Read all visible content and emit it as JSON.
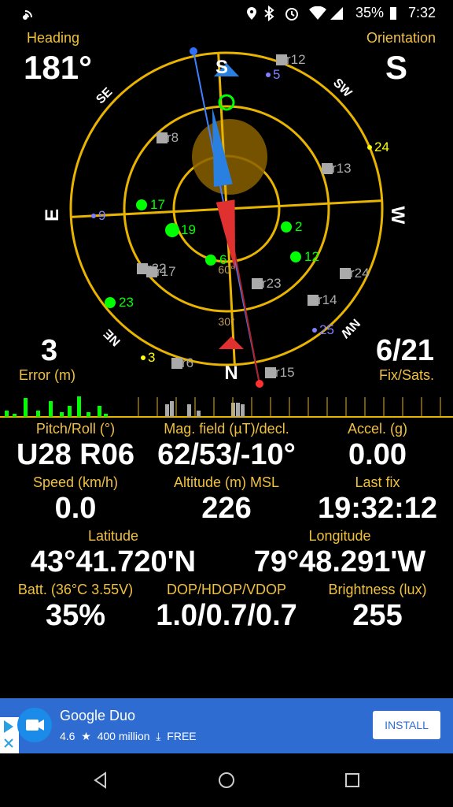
{
  "status": {
    "time": "7:32",
    "battery": "35%"
  },
  "compass": {
    "heading_label": "Heading",
    "heading_value": "181°",
    "orientation_label": "Orientation",
    "orientation_value": "S",
    "error_value": "3",
    "error_label": "Error (m)",
    "fix_value": "6/21",
    "fix_label": "Fix/Sats.",
    "dirs": {
      "top": "S",
      "bottom": "N",
      "left": "E",
      "right": "W",
      "se": "SE",
      "sw": "SW",
      "ne": "NE",
      "nw": "NW"
    },
    "ring_labels": [
      "60°",
      "30°"
    ],
    "satellites": [
      {
        "id": "5",
        "color": "#8080ff"
      },
      {
        "id": "r12",
        "color": "#aaaaaa"
      },
      {
        "id": "r8",
        "color": "#aaaaaa"
      },
      {
        "id": "24",
        "color": "#ffff00"
      },
      {
        "id": "r13",
        "color": "#aaaaaa"
      },
      {
        "id": "9",
        "color": "#8080ff"
      },
      {
        "id": "17",
        "color": "#00ff00"
      },
      {
        "id": "19",
        "color": "#00ff00"
      },
      {
        "id": "2",
        "color": "#00ff00"
      },
      {
        "id": "12",
        "color": "#00ff00"
      },
      {
        "id": "6",
        "color": "#00ff00"
      },
      {
        "id": "r22",
        "color": "#aaaaaa"
      },
      {
        "id": "r17",
        "color": "#aaaaaa"
      },
      {
        "id": "r23",
        "color": "#aaaaaa"
      },
      {
        "id": "r24",
        "color": "#aaaaaa"
      },
      {
        "id": "r14",
        "color": "#aaaaaa"
      },
      {
        "id": "23",
        "color": "#00ff00"
      },
      {
        "id": "25",
        "color": "#8080ff"
      },
      {
        "id": "3",
        "color": "#ffff00"
      },
      {
        "id": "r6",
        "color": "#aaaaaa"
      },
      {
        "id": "r15",
        "color": "#aaaaaa"
      }
    ]
  },
  "readings": {
    "pitch_label": "Pitch/Roll (°)",
    "pitch_value": "U28 R06",
    "mag_label": "Mag. field (µT)/decl.",
    "mag_value": "62/53/-10°",
    "accel_label": "Accel. (g)",
    "accel_value": "0.00",
    "speed_label": "Speed (km/h)",
    "speed_value": "0.0",
    "alt_label": "Altitude (m) MSL",
    "alt_value": "226",
    "lastfix_label": "Last fix",
    "lastfix_value": "19:32:12",
    "lat_label": "Latitude",
    "lat_value": "43°41.720'N",
    "lon_label": "Longitude",
    "lon_value": "79°48.291'W",
    "batt_label": "Batt. (36°C 3.55V)",
    "batt_value": "35%",
    "dop_label": "DOP/HDOP/VDOP",
    "dop_value": "1.0/0.7/0.7",
    "bright_label": "Brightness (lux)",
    "bright_value": "255"
  },
  "ad": {
    "title": "Google Duo",
    "rating": "4.6",
    "downloads": "400 million",
    "price": "FREE",
    "install_label": "INSTALL"
  },
  "colors": {
    "accent": "#f0c040",
    "ad_blue": "#2e6cd1"
  }
}
